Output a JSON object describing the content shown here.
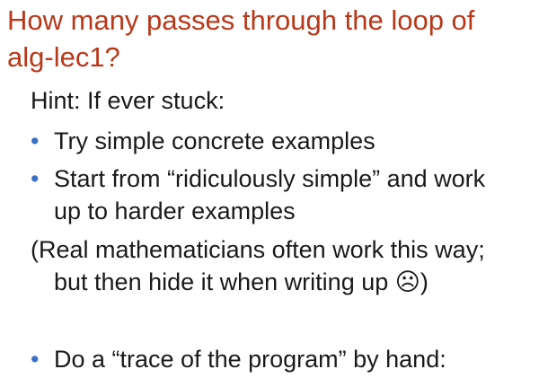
{
  "slide": {
    "title_line1": "How many passes through the loop of",
    "title_line2": "alg-lec1?",
    "hint": "Hint: If ever stuck:",
    "bullet_symbol": "•",
    "items": [
      "Try simple concrete examples",
      "Start from “ridiculously simple” and work",
      "up to harder examples"
    ],
    "note_line1": "(Real mathematicians often work this way;",
    "note_line2": "but then hide it when writing up ☹)",
    "last_item": "Do a “trace of the program” by hand:"
  },
  "colors": {
    "title": "#b8381a",
    "bullet": "#3a6fc4",
    "text": "#1a1a1a"
  }
}
